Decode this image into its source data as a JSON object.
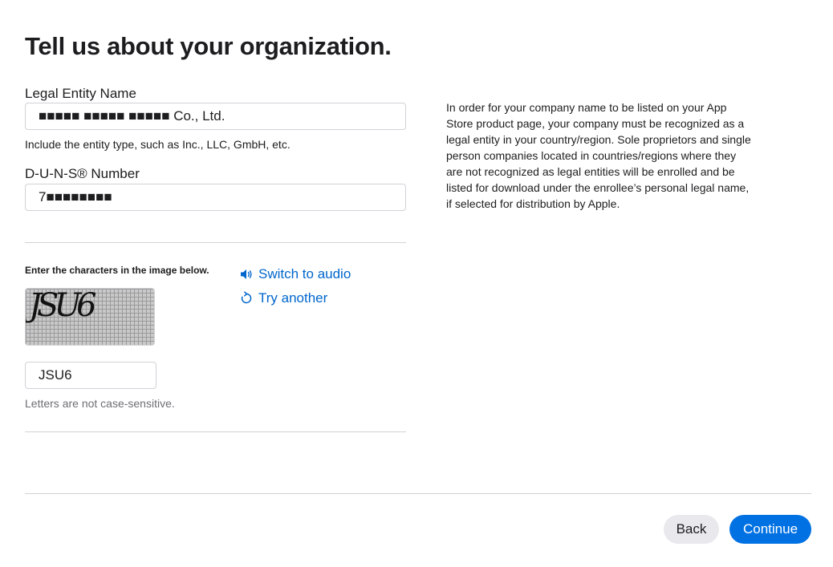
{
  "page": {
    "title": "Tell us about your organization."
  },
  "legal_entity": {
    "label": "Legal Entity Name",
    "value": "■■■■■ ■■■■■ ■■■■■ Co., Ltd.",
    "hint": "Include the entity type, such as Inc., LLC, GmbH, etc."
  },
  "duns": {
    "label": "D-U-N-S® Number",
    "value": "7■■■■■■■■"
  },
  "side_note": {
    "text": "In order for your company name to be listed on your App Store product page, your company must be recognized as a legal entity in your country/region. Sole proprietors and single person companies located in countries/regions where they are not recognized as legal entities will be enrolled and be listed for download under the enrollee’s personal legal name, if selected for distribution by Apple."
  },
  "captcha": {
    "instruction": "Enter the characters in the image below.",
    "image_text": "JSU6",
    "switch_audio_label": "Switch to audio",
    "try_another_label": "Try another",
    "input_value": "JSU6",
    "hint": "Letters are not case-sensitive.",
    "icons": {
      "audio": "speaker-icon",
      "refresh": "refresh-icon"
    }
  },
  "actions": {
    "back_label": "Back",
    "continue_label": "Continue"
  },
  "colors": {
    "text": "#1d1d1f",
    "hint_dark": "#1d1d1f",
    "hint_light": "#6e6e73",
    "link": "#0066cc",
    "primary_button": "#0071e3",
    "secondary_button": "#e8e8ed",
    "border": "#d2d2d7"
  }
}
